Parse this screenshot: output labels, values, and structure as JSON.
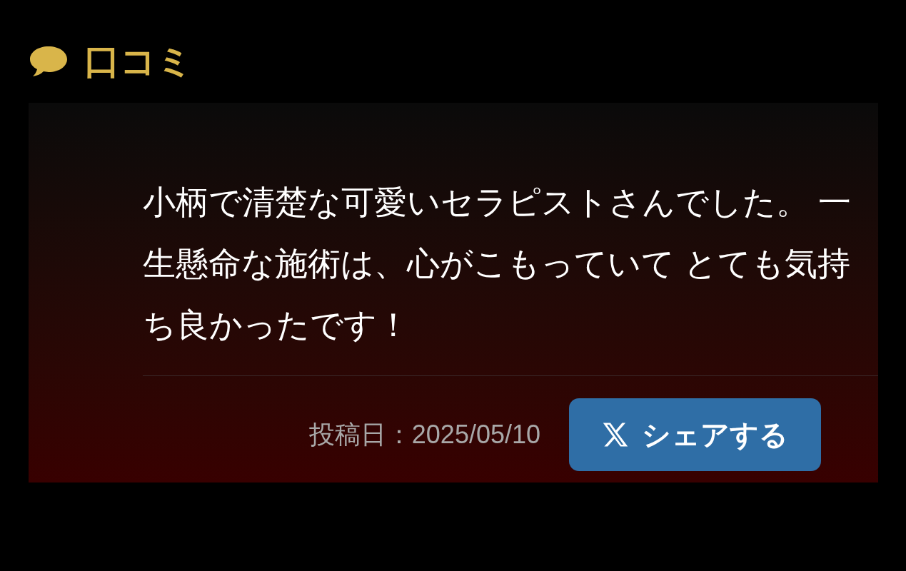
{
  "section": {
    "title": "口コミ"
  },
  "review": {
    "text": "小柄で清楚な可愛いセラピストさんでした。 一生懸命な施術は、心がこもっていて とても気持ち良かったです！",
    "date": "投稿日：2025/05/10"
  },
  "share_button": {
    "label": "シェアする"
  }
}
